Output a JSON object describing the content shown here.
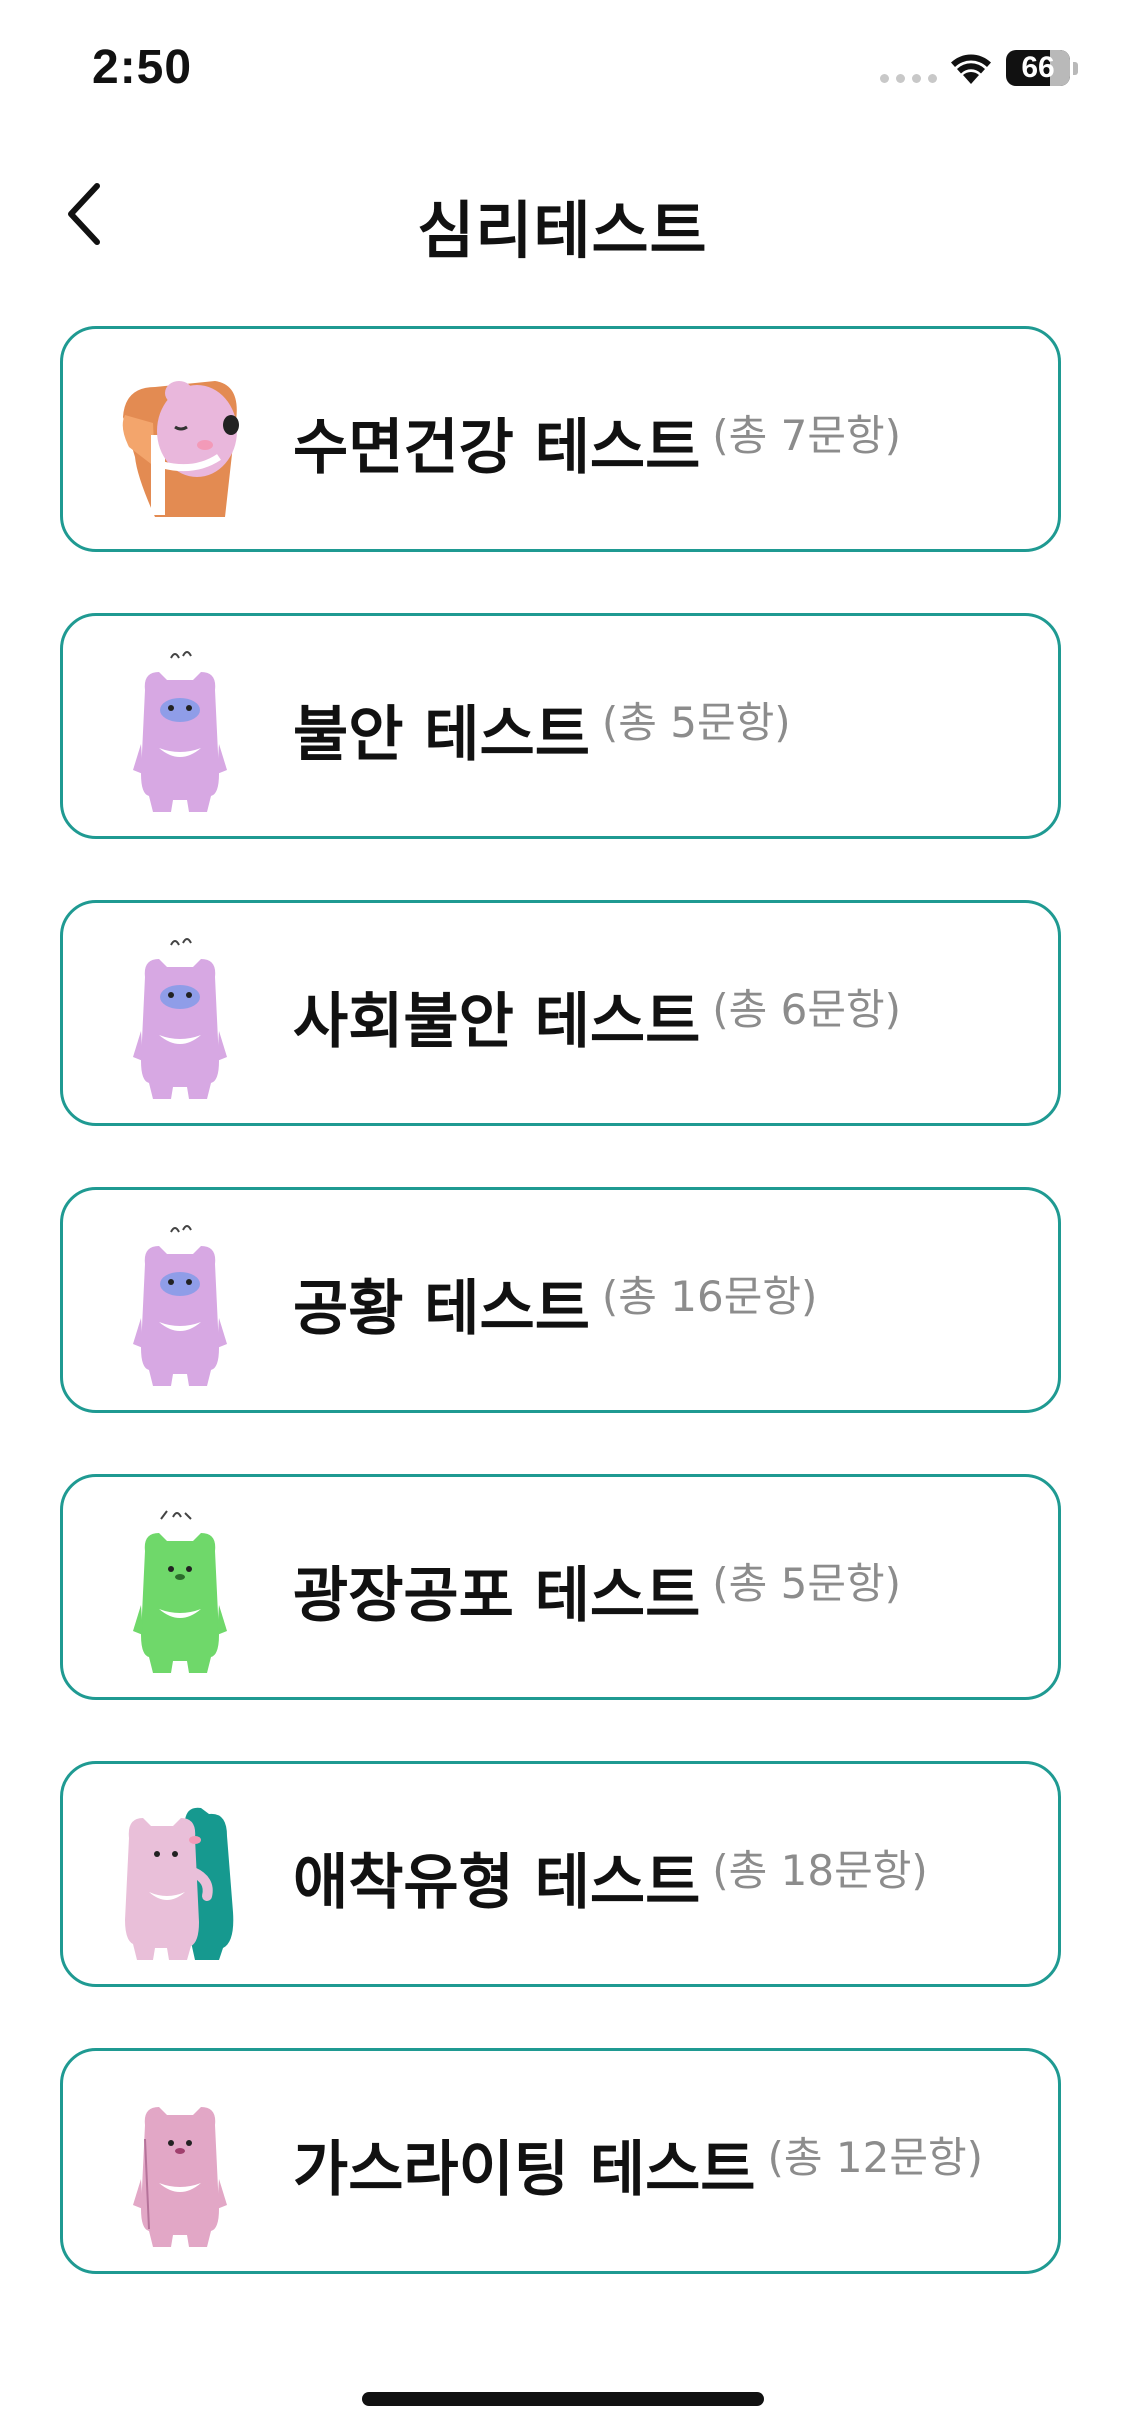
{
  "status_bar": {
    "time": "2:50",
    "battery": "66"
  },
  "nav": {
    "title": "심리테스트"
  },
  "tests": [
    {
      "name": "수면건강 테스트",
      "count": "(총 7문항)",
      "illustration": "sleeping-character",
      "color": "#e6b5d8"
    },
    {
      "name": "불안 테스트",
      "count": "(총 5문항)",
      "illustration": "purple-bear-character",
      "color": "#d7a8e3"
    },
    {
      "name": "사회불안 테스트",
      "count": "(총 6문항)",
      "illustration": "purple-bear-character",
      "color": "#d7a8e3"
    },
    {
      "name": "공황 테스트",
      "count": "(총 16문항)",
      "illustration": "purple-bear-character",
      "color": "#d7a8e3"
    },
    {
      "name": "광장공포 테스트",
      "count": "(총 5문항)",
      "illustration": "green-bear-character",
      "color": "#6fd86a"
    },
    {
      "name": "애착유형 테스트",
      "count": "(총 18문항)",
      "illustration": "hugging-characters",
      "color": "#e9bfd9"
    },
    {
      "name": "가스라이팅 테스트",
      "count": "(총 12문항)",
      "illustration": "pink-bear-character",
      "color": "#e2a7c6"
    }
  ],
  "colors": {
    "card_border": "#1f9a92",
    "count_text": "#8c8c8c",
    "title_text": "#111111"
  }
}
